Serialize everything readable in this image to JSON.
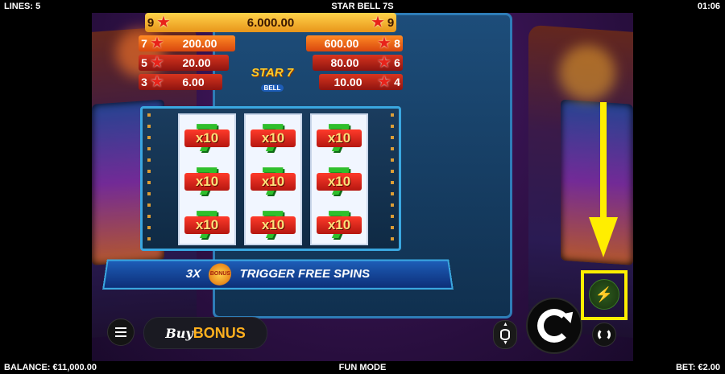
{
  "topbar": {
    "lines": "LINES: 5",
    "title": "STAR BELL 7S",
    "clock": "01:06"
  },
  "bottombar": {
    "balance": "BALANCE: €11,000.00",
    "mode": "FUN MODE",
    "bet": "BET: €2.00"
  },
  "paytable": {
    "top": {
      "count_left": "9",
      "value": "6.000.00",
      "count_right": "9"
    },
    "left": [
      {
        "count": "7",
        "value": "200.00"
      },
      {
        "count": "5",
        "value": "20.00"
      },
      {
        "count": "3",
        "value": "6.00"
      }
    ],
    "right": [
      {
        "count": "8",
        "value": "600.00"
      },
      {
        "count": "6",
        "value": "80.00"
      },
      {
        "count": "4",
        "value": "10.00"
      }
    ]
  },
  "logo": {
    "main": "STAR 7",
    "sub": "BELL"
  },
  "reels": {
    "multiplier_label": "x10",
    "symbol": "7"
  },
  "trigger_banner": {
    "prefix": "3X",
    "badge": "BONUS",
    "text": "TRIGGER FREE SPINS"
  },
  "controls": {
    "buy_label_1": "Buy",
    "buy_label_2": "BONUS",
    "menu_icon": "hamburger-icon",
    "coins_icon": "coins-stack-icon",
    "spin_icon": "spin-arrow-icon",
    "autoplay_icon": "autoplay-icon",
    "turbo_icon": "lightning-icon"
  },
  "colors": {
    "highlight": "#ffee00",
    "accent_orange": "#ffb01e",
    "turbo_green": "#5ee000"
  }
}
